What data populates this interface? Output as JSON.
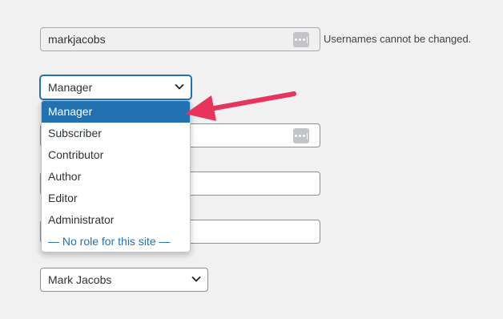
{
  "username": {
    "value": "markjacobs",
    "hint": "Usernames cannot be changed.",
    "badge_icon": "password-manager-icon"
  },
  "role": {
    "selected": "Manager",
    "options": [
      "Manager",
      "Subscriber",
      "Contributor",
      "Author",
      "Editor",
      "Administrator",
      "— No role for this site —"
    ]
  },
  "nickname": {
    "value": "",
    "badge_icon": "password-manager-icon"
  },
  "first_name": {
    "value": ""
  },
  "last_name": {
    "value": ""
  },
  "display_name": {
    "selected": "Mark Jacobs"
  },
  "annotation": {
    "arrow_color": "#e8335a",
    "icon": "arrow-pointer-icon"
  },
  "colors": {
    "accent": "#2271b1",
    "page_bg": "#f1f1f1"
  }
}
